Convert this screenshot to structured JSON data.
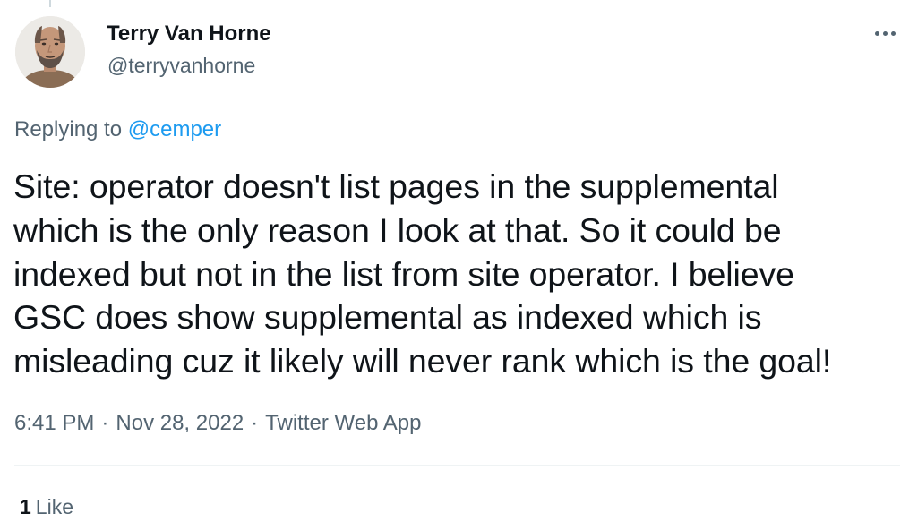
{
  "author": {
    "display_name": "Terry Van Horne",
    "handle": "@terryvanhorne"
  },
  "more_icon": "more-horizontal-icon",
  "reply": {
    "prefix": "Replying to",
    "mention": "@cemper"
  },
  "tweet": {
    "text": "Site: operator doesn't list pages in the supplemental\nwhich is the only reason I look at that. So it could be\nindexed but not in the list from site operator. I believe\nGSC does show supplemental as indexed which is\nmisleading cuz it likely will never rank which is the goal!"
  },
  "meta": {
    "time": "6:41 PM",
    "separator": "·",
    "date": "Nov 28, 2022",
    "source": "Twitter Web App"
  },
  "engagement": {
    "like_count": "1",
    "like_label": "Like"
  },
  "colors": {
    "text_primary": "#0f1419",
    "text_secondary": "#536471",
    "accent": "#1d9bf0",
    "divider": "#eff3f4"
  }
}
